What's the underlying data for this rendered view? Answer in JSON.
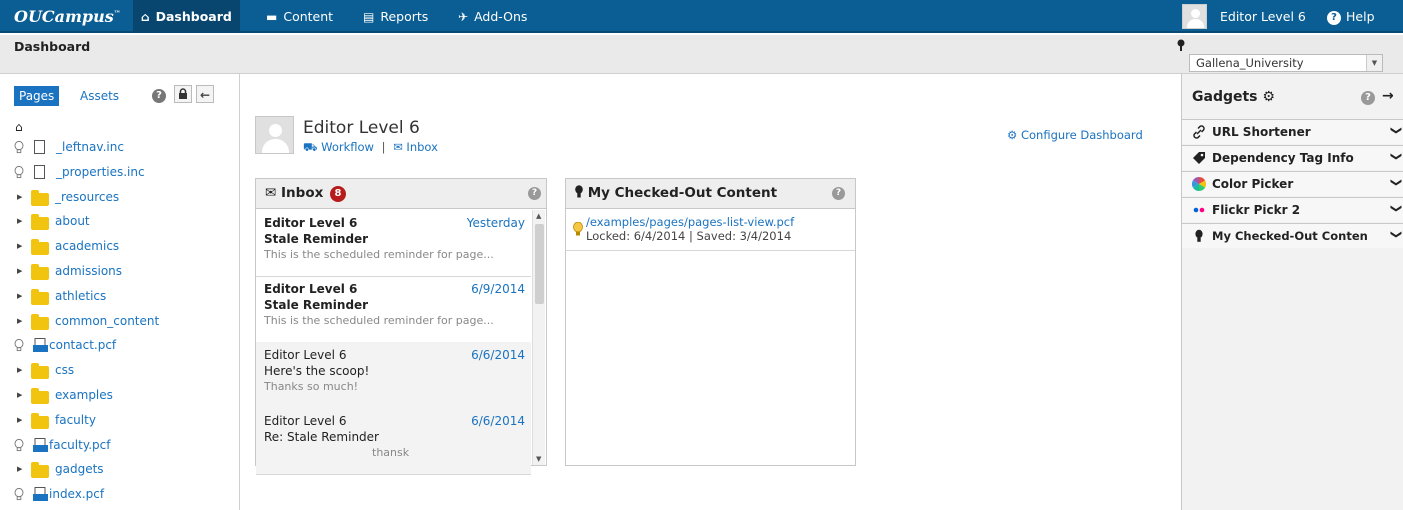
{
  "topnav": {
    "brand": "OUCampus",
    "items": [
      {
        "label": "Dashboard",
        "icon": "home-icon"
      },
      {
        "label": "Content",
        "icon": "folder-icon"
      },
      {
        "label": "Reports",
        "icon": "clipboard-icon"
      },
      {
        "label": "Add-Ons",
        "icon": "pushpin-icon"
      }
    ],
    "user_name": "Editor Level 6",
    "help_label": "Help"
  },
  "breadcrumb": {
    "title": "Dashboard"
  },
  "site_selector": {
    "value": "Gallena_University"
  },
  "sidebar": {
    "tabs": [
      "Pages",
      "Assets"
    ],
    "items": [
      {
        "label": "_leftnav.inc",
        "type": "file"
      },
      {
        "label": "_properties.inc",
        "type": "file"
      },
      {
        "label": "_resources",
        "type": "folder"
      },
      {
        "label": "about",
        "type": "folder"
      },
      {
        "label": "academics",
        "type": "folder"
      },
      {
        "label": "admissions",
        "type": "folder"
      },
      {
        "label": "athletics",
        "type": "folder"
      },
      {
        "label": "common_content",
        "type": "folder"
      },
      {
        "label": "contact.pcf",
        "type": "pcf"
      },
      {
        "label": "css",
        "type": "folder"
      },
      {
        "label": "examples",
        "type": "folder"
      },
      {
        "label": "faculty",
        "type": "folder"
      },
      {
        "label": "faculty.pcf",
        "type": "pcf"
      },
      {
        "label": "gadgets",
        "type": "folder"
      },
      {
        "label": "index.pcf",
        "type": "pcf"
      }
    ]
  },
  "profile": {
    "name": "Editor Level 6",
    "workflow_label": "Workflow",
    "separator": "|",
    "inbox_label": "Inbox"
  },
  "configure_label": "Configure Dashboard",
  "inbox": {
    "title": "Inbox",
    "unread_count": "8",
    "messages": [
      {
        "from": "Editor Level 6",
        "date": "Yesterday",
        "subject": "Stale Reminder",
        "preview": "This is the scheduled reminder for page..."
      },
      {
        "from": "Editor Level 6",
        "date": "6/9/2014",
        "subject": "Stale Reminder",
        "preview": "This is the scheduled reminder for page..."
      },
      {
        "from": "Editor Level 6",
        "date": "6/6/2014",
        "subject": "Here's the scoop!",
        "preview": "Thanks so much!"
      },
      {
        "from": "Editor Level 6",
        "date": "6/6/2014",
        "subject": "Re: Stale Reminder",
        "preview": "thansk"
      }
    ]
  },
  "checked_out": {
    "title": "My Checked-Out Content",
    "items": [
      {
        "path": "/examples/pages/pages-list-view.pcf",
        "meta": "Locked: 6/4/2014 | Saved: 3/4/2014"
      }
    ]
  },
  "gadgets": {
    "title": "Gadgets",
    "items": [
      {
        "label": "URL Shortener",
        "icon": "link-icon"
      },
      {
        "label": "Dependency Tag Info",
        "icon": "tag-icon"
      },
      {
        "label": "Color Picker",
        "icon": "color-wheel-icon"
      },
      {
        "label": "Flickr Pickr 2",
        "icon": "flickr-icon"
      },
      {
        "label": "My Checked-Out Conten",
        "icon": "lightbulb-icon"
      }
    ]
  }
}
